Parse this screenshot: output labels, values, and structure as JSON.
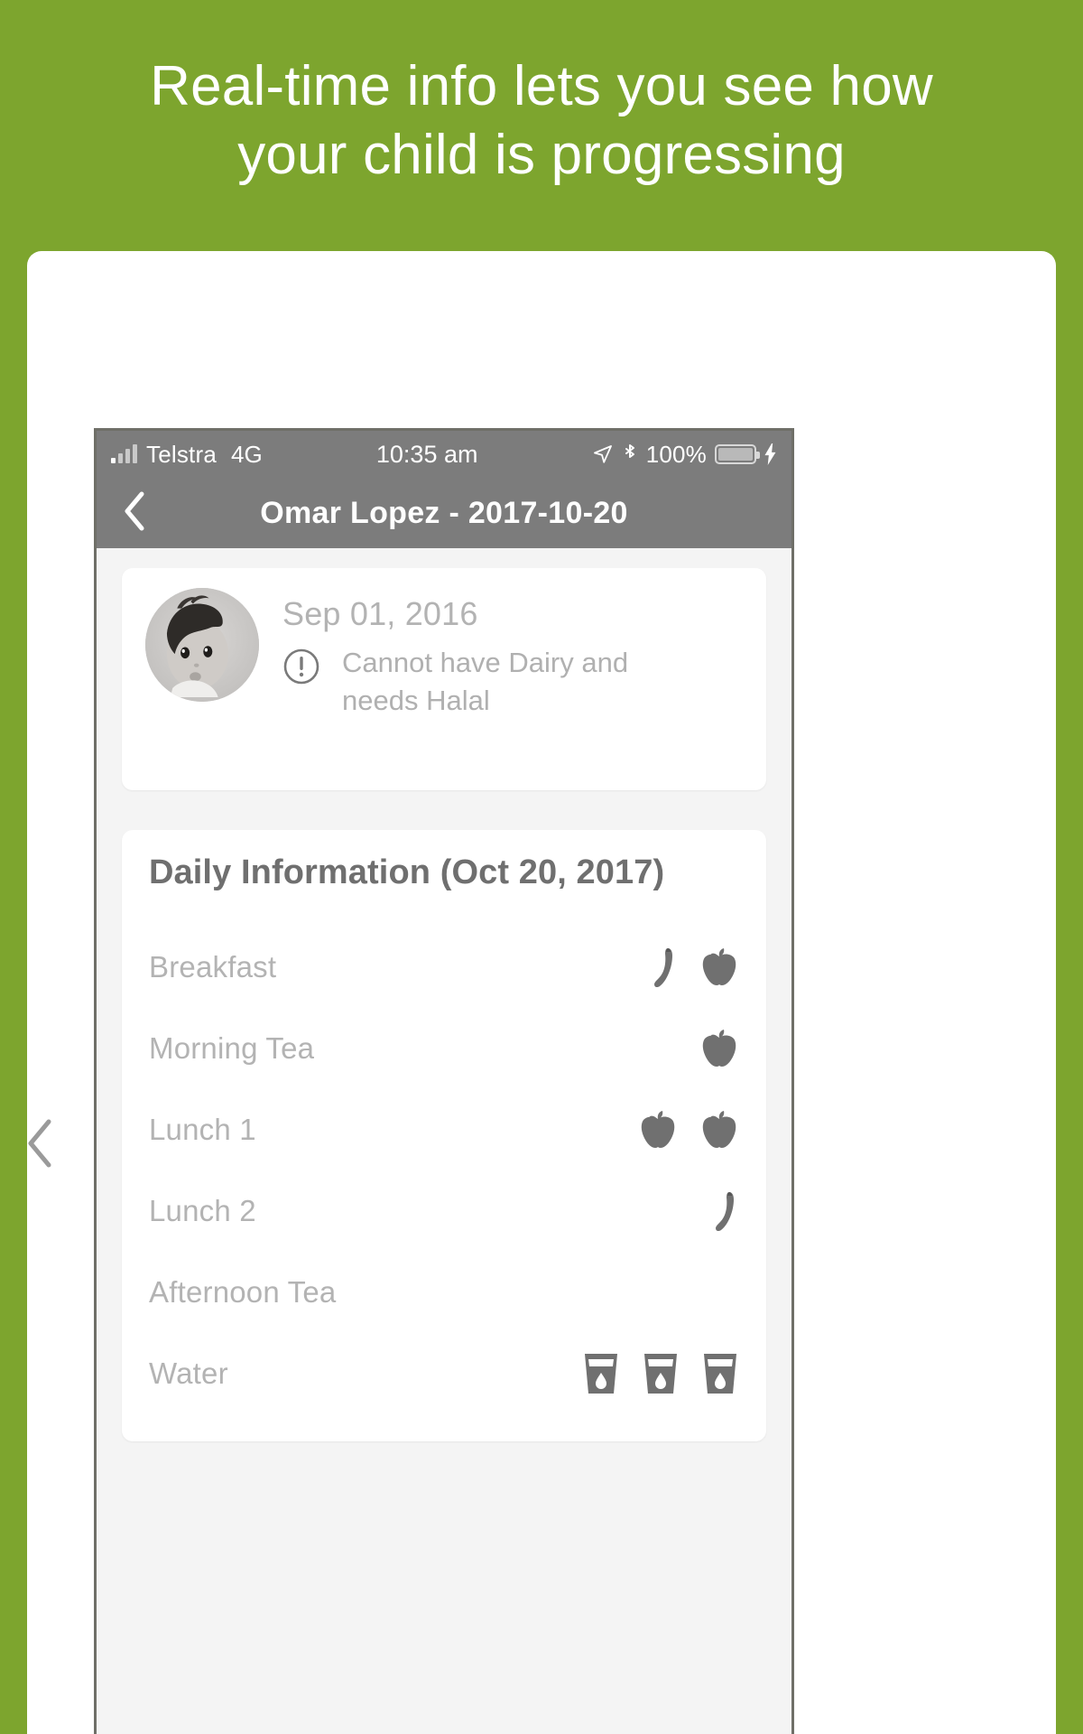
{
  "promo": {
    "line1": "Real-time info lets you see how",
    "line2": "your child is progressing",
    "background_color": "#7da52e",
    "text_color": "#ffffff"
  },
  "phone": {
    "status_bar": {
      "carrier": "Telstra",
      "network": "4G",
      "time": "10:35 am",
      "battery_percent": "100%",
      "signal_icon": "signal-bars-icon",
      "location_icon": "location-arrow-icon",
      "bluetooth_icon": "bluetooth-icon",
      "battery_icon": "battery-icon",
      "charging_icon": "lightning-bolt-icon",
      "background_color": "#7c7c7c"
    },
    "nav_bar": {
      "back_icon": "chevron-left-icon",
      "title": "Omar Lopez - 2017-10-20",
      "background_color": "#7c7c7c"
    },
    "profile_card": {
      "avatar_icon": "child-photo-avatar",
      "birth_date": "Sep 01, 2016",
      "alert_icon": "exclamation-circle-icon",
      "allergy_note": "Cannot have Dairy and needs Halal"
    },
    "daily_information": {
      "title": "Daily Information (Oct 20, 2017)",
      "rows": [
        {
          "label": "Breakfast",
          "icons": [
            "banana-icon",
            "apple-icon"
          ]
        },
        {
          "label": "Morning Tea",
          "icons": [
            "apple-icon"
          ]
        },
        {
          "label": "Lunch 1",
          "icons": [
            "apple-icon",
            "apple-icon"
          ]
        },
        {
          "label": "Lunch 2",
          "icons": [
            "banana-icon"
          ]
        },
        {
          "label": "Afternoon Tea",
          "icons": []
        },
        {
          "label": "Water",
          "icons": [
            "water-cup-icon",
            "water-cup-icon",
            "water-cup-icon"
          ]
        }
      ]
    },
    "side_chevron_icon": "chevron-left-icon"
  }
}
